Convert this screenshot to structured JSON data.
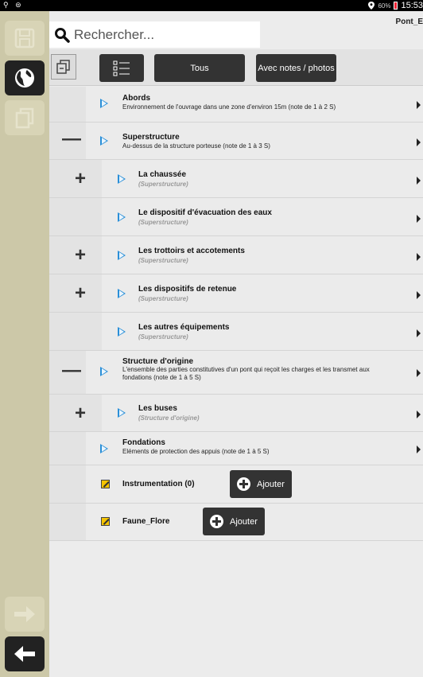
{
  "status": {
    "left_icons": "⚲ ⊜",
    "battery": "60%",
    "time": "15:53"
  },
  "header": {
    "search_label": "Rechercher...",
    "filename": "Pont_E"
  },
  "toolbar": {
    "all_label": "Tous",
    "notes_label": "Avec notes / photos"
  },
  "tree": [
    {
      "title": "Abords",
      "desc": "Environnement de l'ouvrage dans une zone d'environ 15m (note de 1 à 2 S)"
    },
    {
      "title": "Superstructure",
      "desc": "Au-dessus de la structure porteuse (note de 1 à 3 S)"
    },
    {
      "title": "La chaussée",
      "sub": "(Superstructure)"
    },
    {
      "title": "Le dispositif d'évacuation des eaux",
      "sub": "(Superstructure)"
    },
    {
      "title": "Les trottoirs et accotements",
      "sub": "(Superstructure)"
    },
    {
      "title": "Les dispositifs de retenue",
      "sub": "(Superstructure)"
    },
    {
      "title": "Les autres équipements",
      "sub": "(Superstructure)"
    },
    {
      "title": "Structure d'origine",
      "desc": "L'ensemble des parties constitutives d'un pont qui reçoit les charges et les transmet aux fondations (note de 1 à 5 S)"
    },
    {
      "title": "Les buses",
      "sub": "(Structure d'origine)"
    },
    {
      "title": "Fondations",
      "desc": "Eléments de protection des appuis (note de 1 à 5 S)"
    }
  ],
  "extras": [
    {
      "title": "Instrumentation (0)",
      "button": "Ajouter"
    },
    {
      "title": "Faune_Flore",
      "button": "Ajouter"
    }
  ],
  "colors": {
    "accent_blue": "#2a8fd8",
    "sidebar": "#ccc8a8",
    "note_yellow": "#f5c400",
    "dark_button": "#333333"
  }
}
